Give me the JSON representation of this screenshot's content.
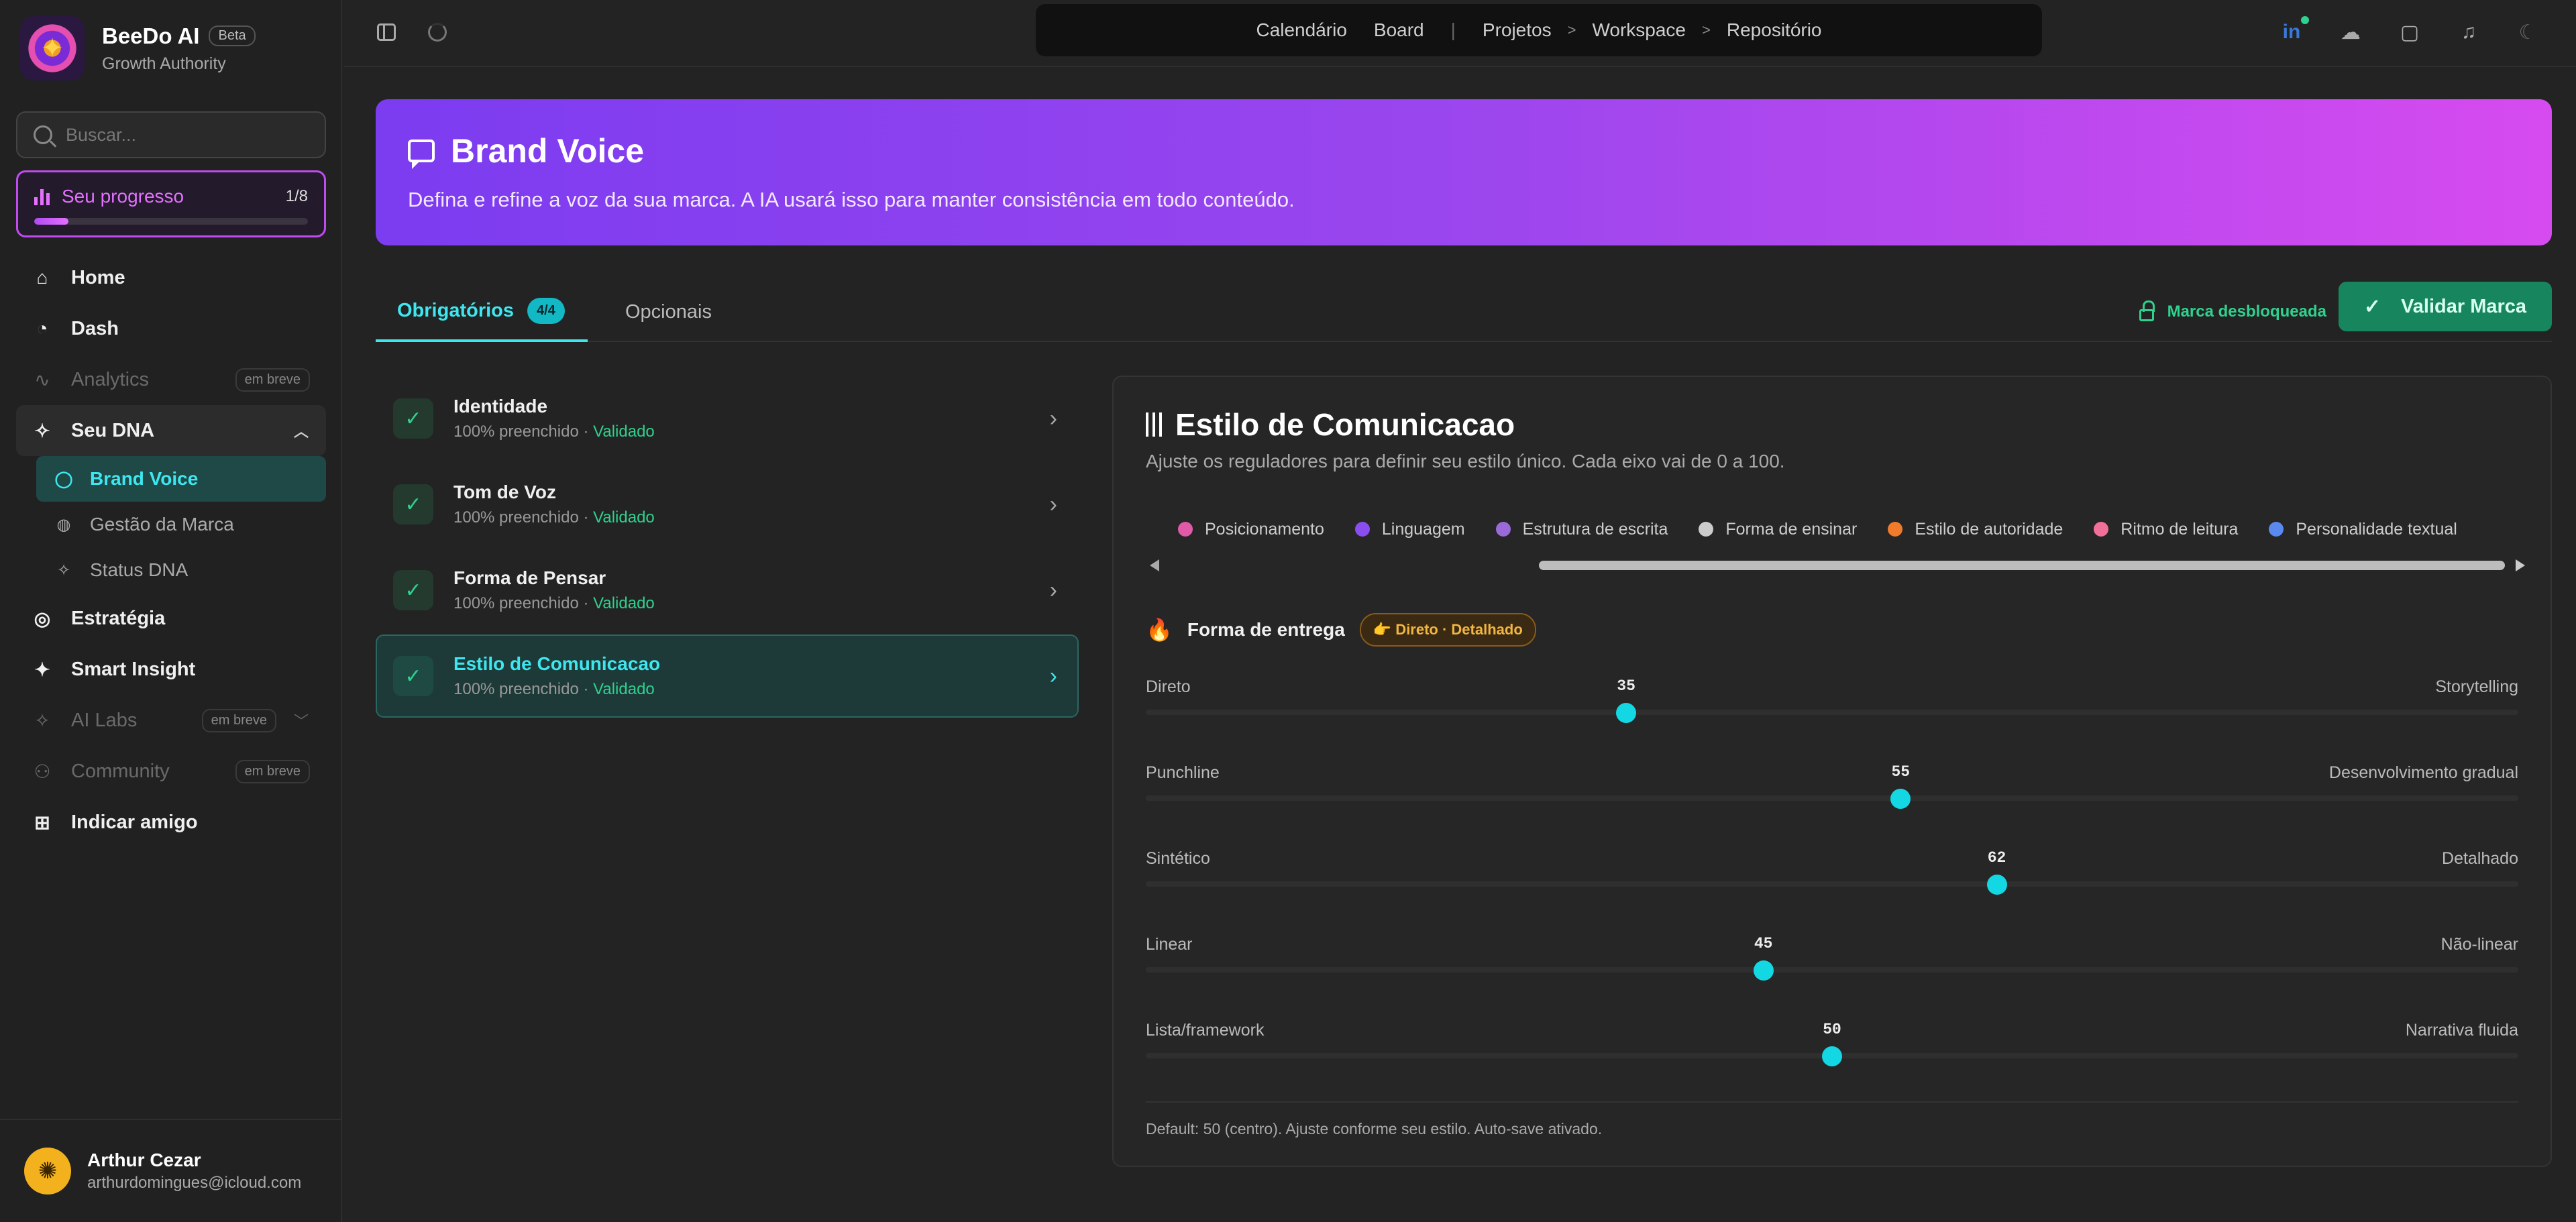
{
  "app": {
    "name": "BeeDo AI",
    "badge": "Beta",
    "subtitle": "Growth Authority"
  },
  "search": {
    "placeholder": "Buscar..."
  },
  "progress": {
    "label": "Seu progresso",
    "count": "1/8",
    "fraction": 0.125,
    "color": "#e470ff"
  },
  "nav": {
    "home": "Home",
    "dash": "Dash",
    "analytics": "Analytics",
    "analytics_badge": "em breve",
    "dna": "Seu DNA",
    "dna_children": [
      "Brand Voice",
      "Gestão da Marca",
      "Status DNA"
    ],
    "estrategia": "Estratégia",
    "smart_insight": "Smart Insight",
    "ai_labs": "AI Labs",
    "ai_labs_badge": "em breve",
    "community": "Community",
    "community_badge": "em breve",
    "indicar": "Indicar amigo"
  },
  "user": {
    "name": "Arthur Cezar",
    "email": "arthurdomingues@icloud.com"
  },
  "topnav": [
    "Calendário",
    "Board",
    "Projetos",
    "Workspace",
    "Repositório"
  ],
  "banner": {
    "title": "Brand Voice",
    "subtitle": "Defina e refine a voz da sua marca. A IA usará isso para manter consistência em todo conteúdo."
  },
  "tabs": {
    "required": "Obrigatórios",
    "required_badge": "4/4",
    "optional": "Opcionais",
    "unlocked": "Marca desbloqueada",
    "validate": "Validar Marca"
  },
  "steps": [
    {
      "title": "Identidade",
      "filled": "100% preenchido",
      "status": "Validado"
    },
    {
      "title": "Tom de Voz",
      "filled": "100% preenchido",
      "status": "Validado"
    },
    {
      "title": "Forma de Pensar",
      "filled": "100% preenchido",
      "status": "Validado"
    },
    {
      "title": "Estilo de Comunicacao",
      "filled": "100% preenchido",
      "status": "Validado"
    }
  ],
  "panel": {
    "title": "Estilo de Comunicacao",
    "subtitle": "Ajuste os reguladores para definir seu estilo único. Cada eixo vai de 0 a 100.",
    "categories": [
      {
        "label": "Posicionamento",
        "color": "#e05aa8"
      },
      {
        "label": "Linguagem",
        "color": "#8a4ef0"
      },
      {
        "label": "Estrutura de escrita",
        "color": "#9a6ad8"
      },
      {
        "label": "Forma de ensinar",
        "color": "#cccccc"
      },
      {
        "label": "Estilo de autoridade",
        "color": "#f07b2b"
      },
      {
        "label": "Ritmo de leitura",
        "color": "#f0709a"
      },
      {
        "label": "Personalidade textual",
        "color": "#5a8af0"
      }
    ],
    "section": {
      "title": "Forma de entrega",
      "badge": "👉 Direto · Detalhado"
    },
    "sliders": [
      {
        "left": "Direto",
        "right": "Storytelling",
        "value": 35
      },
      {
        "left": "Punchline",
        "right": "Desenvolvimento gradual",
        "value": 55
      },
      {
        "left": "Sintético",
        "right": "Detalhado",
        "value": 62
      },
      {
        "left": "Linear",
        "right": "Não-linear",
        "value": 45
      },
      {
        "left": "Lista/framework",
        "right": "Narrativa fluida",
        "value": 50
      }
    ],
    "footer": "Default: 50 (centro). Ajuste conforme seu estilo. Auto-save ativado."
  },
  "colors": {
    "accent": "#3ee7f0",
    "success": "#2fd18f",
    "purple": "#b14af2"
  }
}
